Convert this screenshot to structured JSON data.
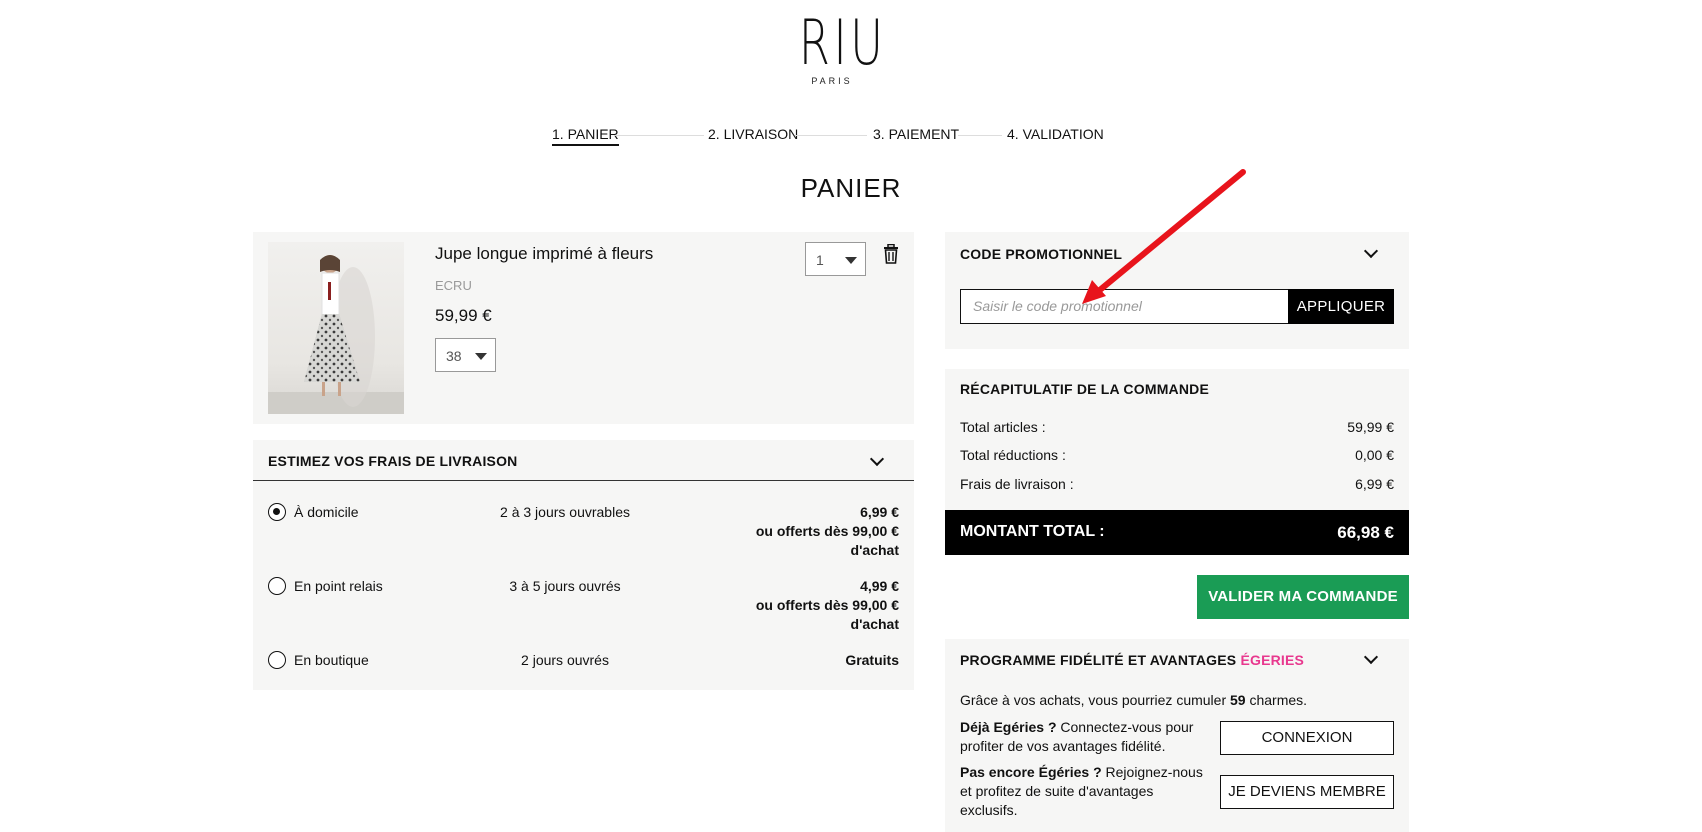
{
  "brand": {
    "name": "RIU",
    "city": "PARIS"
  },
  "steps": [
    "1. PANIER",
    "2. LIVRAISON",
    "3. PAIEMENT",
    "4. VALIDATION"
  ],
  "page_title": "PANIER",
  "cart_item": {
    "name": "Jupe longue imprimé à fleurs",
    "color": "ECRU",
    "price": "59,99 €",
    "size": "38",
    "quantity": "1"
  },
  "delivery": {
    "title": "ESTIMEZ VOS FRAIS DE LIVRAISON",
    "options": [
      {
        "label": "À domicile",
        "delay": "2 à 3 jours ouvrables",
        "price": "6,99 €",
        "offer_line1": "ou offerts dès 99,00 €",
        "offer_line2": "d'achat",
        "selected": true
      },
      {
        "label": "En point relais",
        "delay": "3 à 5 jours ouvrés",
        "price": "4,99 €",
        "offer_line1": "ou offerts dès 99,00 €",
        "offer_line2": "d'achat",
        "selected": false
      },
      {
        "label": "En boutique",
        "delay": "2 jours ouvrés",
        "price": "Gratuits",
        "selected": false
      }
    ]
  },
  "promo": {
    "title": "CODE PROMOTIONNEL",
    "placeholder": "Saisir le code promotionnel",
    "apply_label": "APPLIQUER"
  },
  "summary": {
    "title": "RÉCAPITULATIF DE LA COMMANDE",
    "rows": [
      {
        "label": "Total articles :",
        "amount": "59,99 €"
      },
      {
        "label": "Total réductions :",
        "amount": "0,00 €"
      },
      {
        "label": "Frais de livraison :",
        "amount": "6,99 €"
      }
    ],
    "total_label": "MONTANT TOTAL :",
    "total_amount": "66,98 €"
  },
  "validate_label": "VALIDER MA COMMANDE",
  "loyalty": {
    "title_prefix": "PROGRAMME FIDÉLITÉ ET AVANTAGES ",
    "title_highlight": "ÉGERIES",
    "intro_prefix": "Grâce à vos achats, vous pourriez cumuler ",
    "charms": "59",
    "intro_suffix": " charmes.",
    "member_bold": "Déjà Egéries ?",
    "member_text": " Connectez-vous pour profiter de vos avantages fidélité.",
    "member_button": "CONNEXION",
    "join_bold": "Pas encore Égéries ?",
    "join_text": " Rejoignez-nous et profitez de suite d'avantages exclusifs.",
    "join_button": "JE DEVIENS MEMBRE"
  },
  "colors": {
    "accent_green": "#1a9c55",
    "accent_pink": "#e8388e",
    "annotation_arrow": "#e8141c"
  }
}
